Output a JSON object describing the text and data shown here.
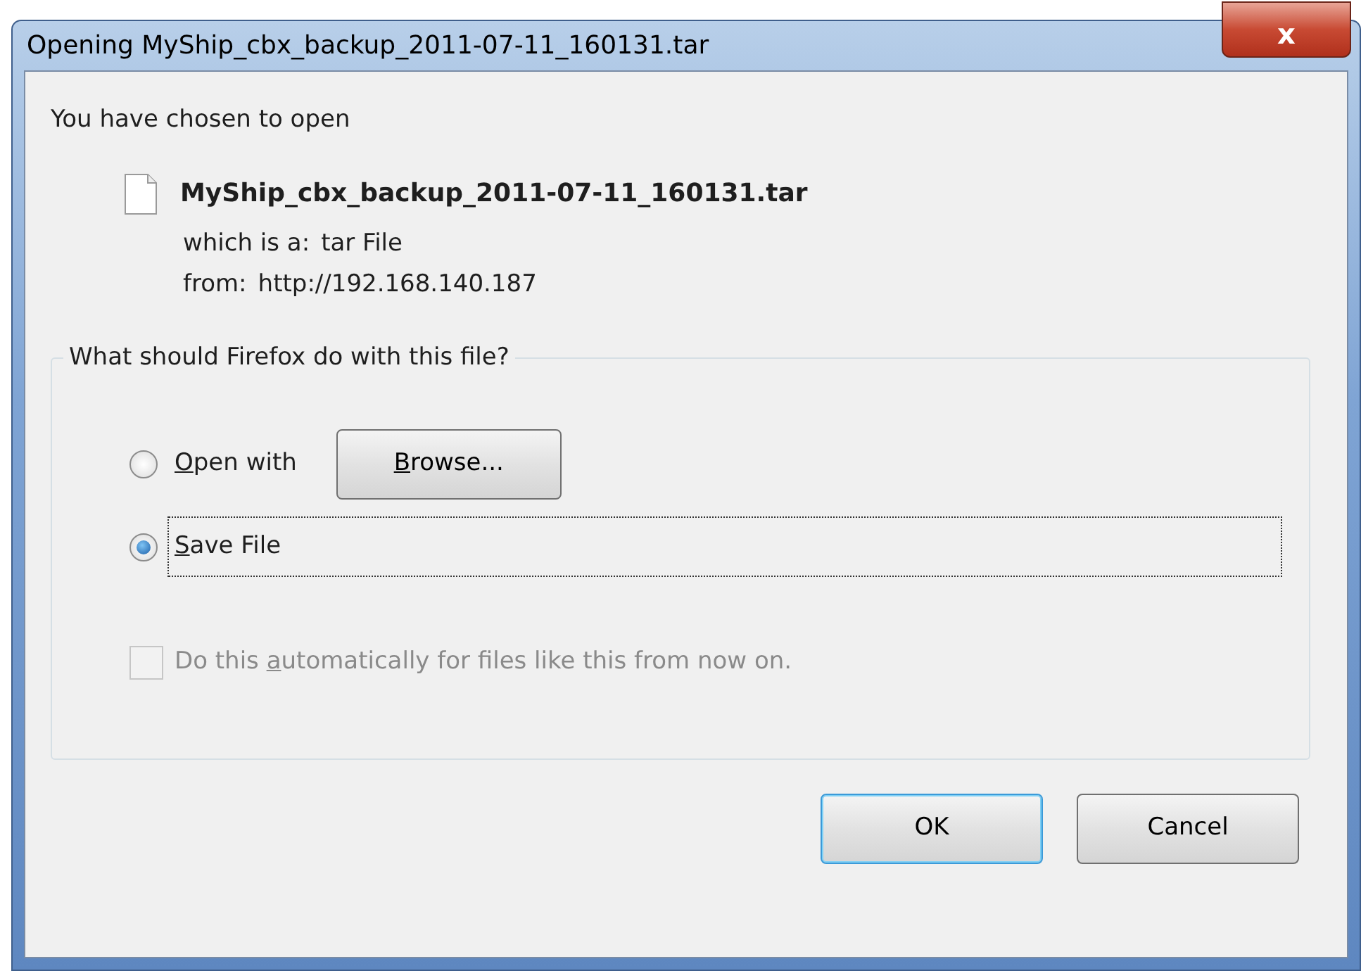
{
  "window": {
    "title": "Opening MyShip_cbx_backup_2011-07-11_160131.tar",
    "close_glyph": "x"
  },
  "intro": "You have chosen to open",
  "file": {
    "name": "MyShip_cbx_backup_2011-07-11_160131.tar",
    "type_label": "which is a:",
    "type_value": "tar File",
    "from_label": "from:",
    "from_value": "http://192.168.140.187"
  },
  "group": {
    "legend": "What should Firefox do with this file?",
    "options": [
      {
        "kind": "radio",
        "key": "O",
        "after": "pen with",
        "selected": false,
        "focused": false,
        "button": {
          "key": "B",
          "after": "rowse..."
        }
      },
      {
        "kind": "radio",
        "key": "S",
        "after": "ave File",
        "selected": true,
        "focused": true
      },
      {
        "kind": "checkbox",
        "before": "Do this ",
        "key": "a",
        "after": "utomatically for files like this from now on.",
        "checked": false,
        "disabled": true
      }
    ]
  },
  "buttons": [
    {
      "label": "OK",
      "default": true
    },
    {
      "label": "Cancel",
      "default": false
    }
  ]
}
